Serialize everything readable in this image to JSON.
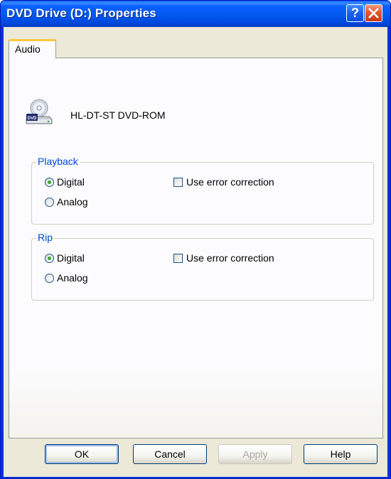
{
  "window": {
    "title": "DVD Drive (D:) Properties"
  },
  "titlebar_buttons": {
    "help_label": "?",
    "close_icon": "close-x-icon"
  },
  "tabs": [
    {
      "label": "Audio",
      "selected": true
    }
  ],
  "drive": {
    "icon": "dvd-drive-icon",
    "name": "HL-DT-ST DVD-ROM"
  },
  "playback": {
    "label": "Playback",
    "digital_label": "Digital",
    "analog_label": "Analog",
    "selected": "Digital",
    "error_correction_label": "Use error correction",
    "error_correction_checked": false
  },
  "rip": {
    "label": "Rip",
    "digital_label": "Digital",
    "analog_label": "Analog",
    "selected": "Digital",
    "error_correction_label": "Use error correction",
    "error_correction_checked": false
  },
  "buttons": {
    "ok": "OK",
    "cancel": "Cancel",
    "apply": "Apply",
    "help": "Help"
  }
}
